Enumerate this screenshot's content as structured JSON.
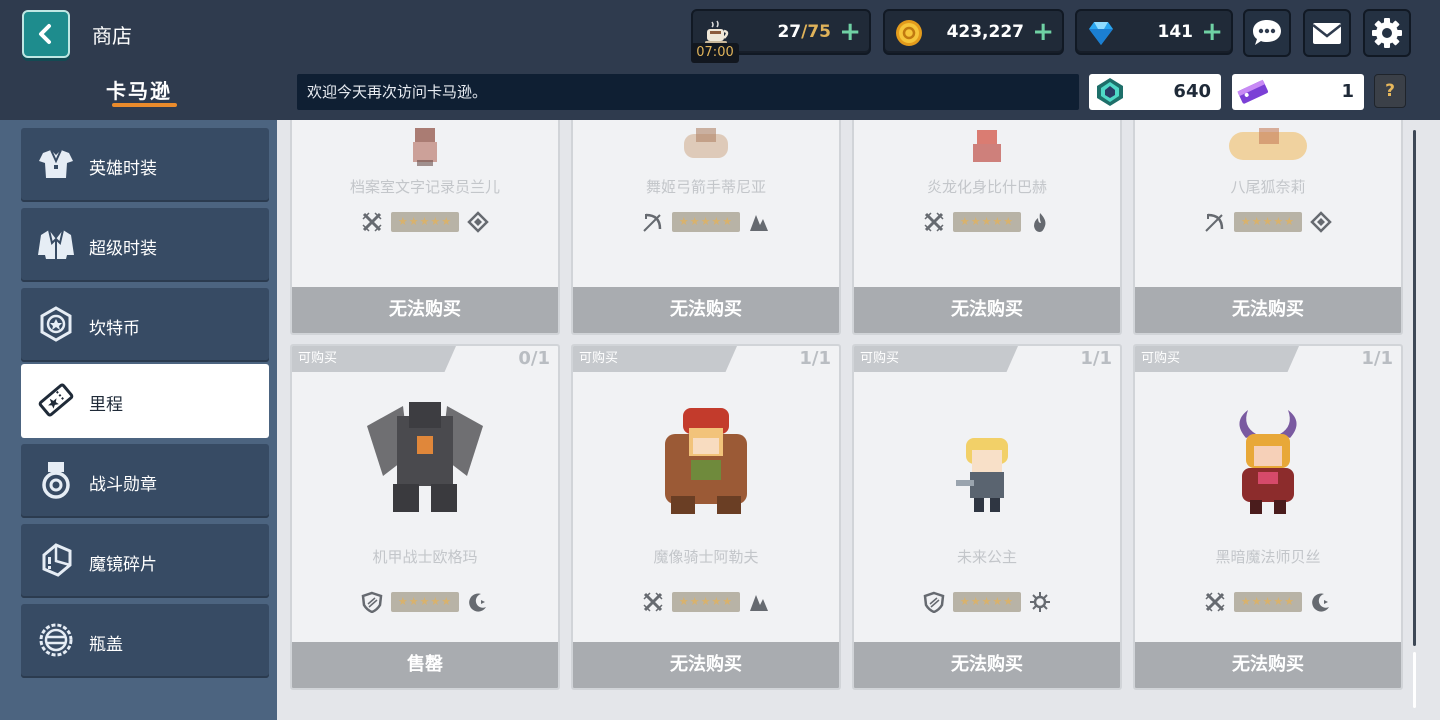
{
  "header": {
    "title": "商店",
    "resources": {
      "stamina": {
        "current": "27",
        "max": "/75",
        "timer": "07:00",
        "icon": "coffee-cup-icon"
      },
      "gold": {
        "value": "423,227",
        "icon": "gold-coin-icon"
      },
      "gems": {
        "value": "141",
        "icon": "diamond-icon"
      }
    },
    "plus": "+",
    "icons": [
      "chat-bubble-icon",
      "mail-icon",
      "gear-icon"
    ]
  },
  "subheader": {
    "shop_name": "卡马逊",
    "notice": "欢迎今天再次访问卡马逊。",
    "currency_1": {
      "value": "640",
      "icon": "green-crest-icon"
    },
    "currency_2": {
      "value": "1",
      "icon": "ticket-icon"
    },
    "help": "?"
  },
  "sidebar": {
    "items": [
      {
        "label": "英雄时装",
        "icon": "hero-costume-icon",
        "active": false
      },
      {
        "label": "超级时装",
        "icon": "super-costume-icon",
        "active": false
      },
      {
        "label": "坎特币",
        "icon": "kanterbury-coin-icon",
        "active": false
      },
      {
        "label": "里程",
        "icon": "mileage-ticket-icon",
        "active": true
      },
      {
        "label": "战斗勋章",
        "icon": "battle-medal-icon",
        "active": false
      },
      {
        "label": "魔镜碎片",
        "icon": "mirror-shard-icon",
        "active": false
      },
      {
        "label": "瓶盖",
        "icon": "bottle-cap-icon",
        "active": false
      }
    ]
  },
  "shop": {
    "row1": [
      {
        "name": "档案室文字记录员兰儿",
        "button": "无法购买",
        "role_icon": "sword-icon",
        "element_icon": "earth-icon"
      },
      {
        "name": "舞姬弓箭手蒂尼亚",
        "button": "无法购买",
        "role_icon": "bow-icon",
        "element_icon": "earth-icon"
      },
      {
        "name": "炎龙化身比什巴赫",
        "button": "无法购买",
        "role_icon": "sword-icon",
        "element_icon": "fire-icon"
      },
      {
        "name": "八尾狐奈莉",
        "button": "无法购买",
        "role_icon": "bow-icon",
        "element_icon": "basic-icon"
      }
    ],
    "row2": [
      {
        "badge": "可购买",
        "count": "0/1",
        "name": "机甲战士欧格玛",
        "button": "售罄",
        "role_icon": "shield-icon",
        "element_icon": "dark-icon"
      },
      {
        "badge": "可购买",
        "count": "1/1",
        "name": "魔像骑士阿勒夫",
        "button": "无法购买",
        "role_icon": "sword-icon",
        "element_icon": "earth-icon"
      },
      {
        "badge": "可购买",
        "count": "1/1",
        "name": "未来公主",
        "button": "无法购买",
        "role_icon": "shield-icon",
        "element_icon": "light-icon"
      },
      {
        "badge": "可购买",
        "count": "1/1",
        "name": "黑暗魔法师贝丝",
        "button": "无法购买",
        "role_icon": "sword-icon",
        "element_icon": "dark-icon"
      }
    ],
    "stars": "★★★★★"
  }
}
